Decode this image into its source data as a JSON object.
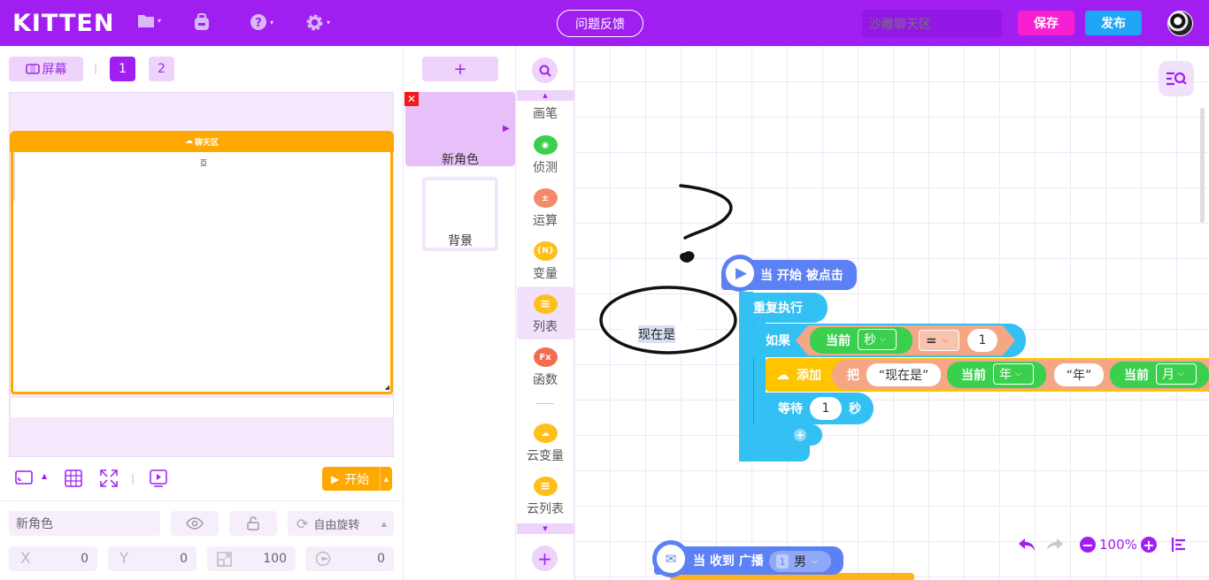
{
  "topbar": {
    "logo": "KITTEN",
    "feedback": "问题反馈",
    "search_placeholder": "沙雕聊天区",
    "save": "保存",
    "publish": "发布"
  },
  "stage": {
    "screen_label": "屏幕",
    "pages": [
      "1",
      "2"
    ],
    "chat_header": "聊天区",
    "chat_top": "亞",
    "start_label": "开始"
  },
  "props": {
    "name": "新角色",
    "rotate": "自由旋转",
    "x_label": "X",
    "x_value": "0",
    "y_label": "Y",
    "y_value": "0",
    "size_value": "100",
    "dir_value": "0"
  },
  "sprites": {
    "add": "+",
    "sprite_name": "新角色",
    "bg_name": "背景"
  },
  "categories": [
    {
      "label": "画笔",
      "color": "#9a59e8",
      "glyph": ""
    },
    {
      "label": "侦测",
      "color": "#3bcf4e",
      "glyph": "◉"
    },
    {
      "label": "运算",
      "color": "#f5896b",
      "glyph": "±"
    },
    {
      "label": "变量",
      "color": "#ffbf1a",
      "glyph": "{N}"
    },
    {
      "label": "列表",
      "color": "#ffbf1a",
      "glyph": "≡"
    },
    {
      "label": "函数",
      "color": "#f26c4f",
      "glyph": "Fx"
    },
    {
      "label": "云变量",
      "color": "#ffbf1a",
      "glyph": "N"
    },
    {
      "label": "云列表",
      "color": "#ffbf1a",
      "glyph": "≡"
    }
  ],
  "blocks": {
    "when_start": "当 开始 被点击",
    "forever": "重复执行",
    "if": "如果",
    "current": "当前",
    "sec": "秒",
    "eq": "=",
    "one": "1",
    "add": "添加",
    "ba": "把",
    "now_is": "“现在是”",
    "year": "年",
    "year_str": "“年”",
    "month": "月",
    "wait": "等待",
    "wait_val": "1",
    "wait_unit": "秒",
    "plus": "+",
    "receive": "当 收到 广播",
    "msg_num": "1",
    "msg_name": "男",
    "bubble_text": "现在是"
  },
  "zoom": "100%"
}
